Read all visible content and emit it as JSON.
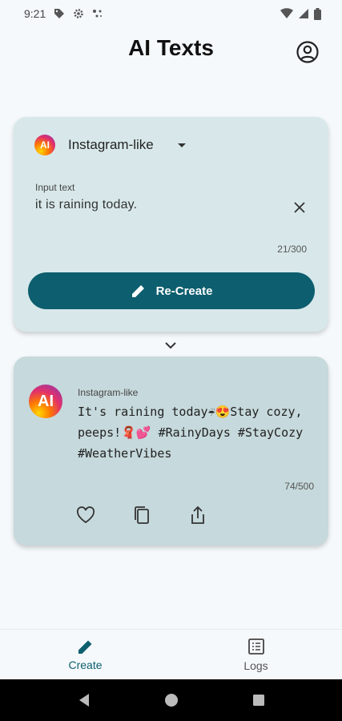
{
  "status_bar": {
    "time": "9:21",
    "left_icons": [
      "tag-icon",
      "settings-gear-icon",
      "assistant-dots-icon"
    ],
    "right_icons": [
      "wifi-icon",
      "cell-signal-icon",
      "battery-icon"
    ]
  },
  "header": {
    "title": "AI Texts",
    "account_icon": "account-circle-icon"
  },
  "input_card": {
    "logo_text": "AI",
    "style_label": "Instagram-like",
    "input_label": "Input text",
    "input_value": "it is raining today.",
    "char_count": "21/300",
    "recreate_label": "Re-Create"
  },
  "result_card": {
    "logo_text": "AI",
    "style_label": "Instagram-like",
    "text": "It's raining today☔😍Stay cozy, peeps!🧣💕 #RainyDays #StayCozy #WeatherVibes",
    "char_count": "74/500",
    "actions": [
      "favorite-icon",
      "copy-icon",
      "share-icon"
    ]
  },
  "bottom_nav": {
    "items": [
      {
        "label": "Create",
        "icon": "pencil-icon",
        "active": true
      },
      {
        "label": "Logs",
        "icon": "list-icon",
        "active": false
      }
    ]
  },
  "colors": {
    "accent": "#0d5e6e",
    "input_card_bg": "#d8e8ea",
    "result_card_bg": "#c6d9dc",
    "page_bg": "#f5f9fb"
  }
}
